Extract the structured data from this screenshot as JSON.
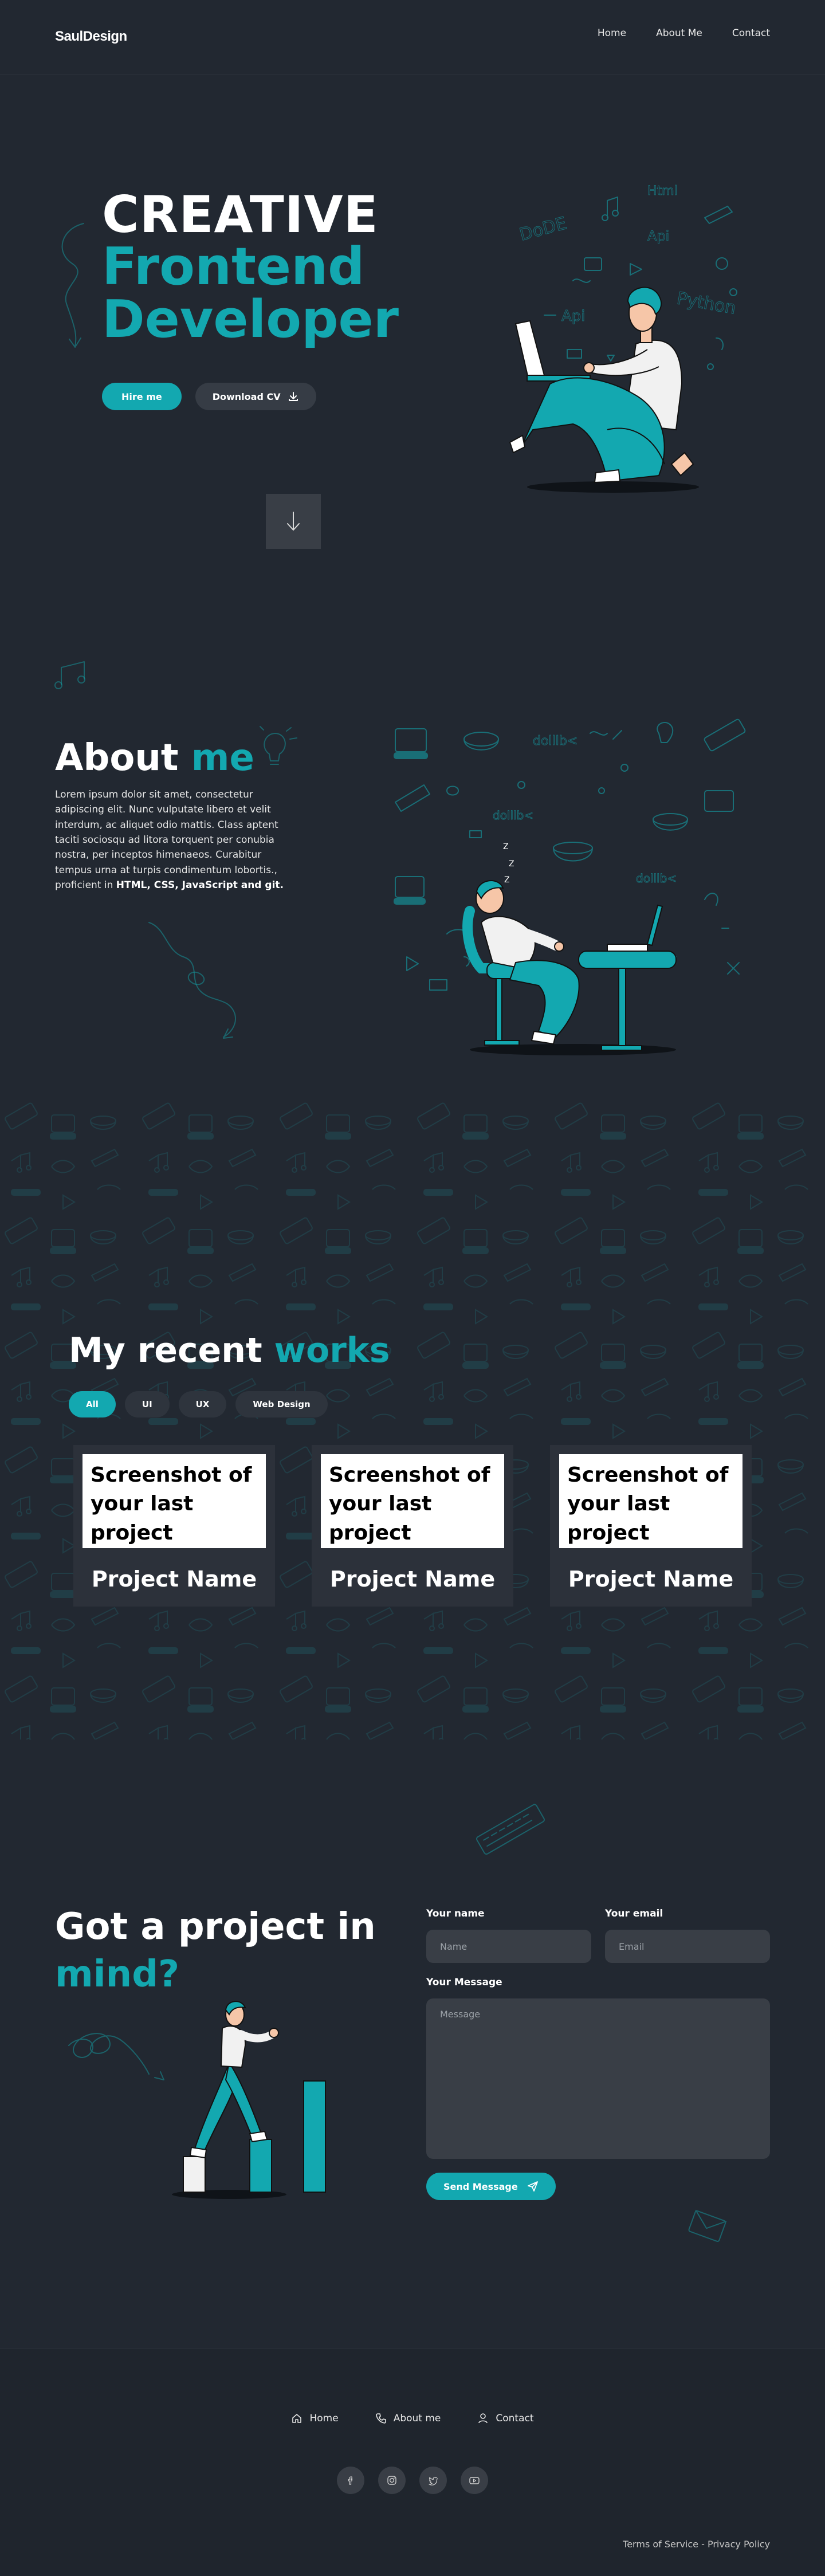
{
  "header": {
    "logo": "SaulDesign",
    "nav": [
      {
        "label": "Home"
      },
      {
        "label": "About Me"
      },
      {
        "label": "Contact"
      }
    ]
  },
  "hero": {
    "line1": "CREATIVE",
    "line2": "Frontend",
    "line3": "Developer",
    "hire_label": "Hire me",
    "cv_label": "Download CV",
    "scroll_icon": "arrow-down-icon"
  },
  "about": {
    "title_plain": "About ",
    "title_accent": "me",
    "text": "Lorem ipsum dolor sit amet, consectetur adipiscing elit. Nunc vulputate libero et velit interdum, ac aliquet odio mattis. Class aptent taciti sociosqu ad litora torquent per conubia nostra, per inceptos himenaeos. Curabitur tempus urna at turpis condimentum lobortis., proficient in ",
    "skills": "HTML, CSS, JavaScript and git."
  },
  "works": {
    "title_plain": "My recent ",
    "title_accent": "works",
    "filters": [
      {
        "label": "All",
        "active": true
      },
      {
        "label": "UI",
        "active": false
      },
      {
        "label": "UX",
        "active": false
      },
      {
        "label": "Web Design",
        "active": false
      }
    ],
    "projects": [
      {
        "screenshot": "Screenshot of your last project",
        "name": "Project Name"
      },
      {
        "screenshot": "Screenshot of your last project",
        "name": "Project Name"
      },
      {
        "screenshot": "Screenshot of your last project",
        "name": "Project Name"
      }
    ]
  },
  "contact": {
    "title_line1": "Got a project in",
    "title_line2": "mind?",
    "name_label": "Your name",
    "name_placeholder": "Name",
    "email_label": "Your email",
    "email_placeholder": "Email",
    "message_label": "Your Message",
    "message_placeholder": "Message",
    "send_label": "Send Message"
  },
  "footer": {
    "links": [
      {
        "label": "Home",
        "icon": "home-icon"
      },
      {
        "label": "About me",
        "icon": "phone-icon"
      },
      {
        "label": "Contact",
        "icon": "user-icon"
      }
    ],
    "socials": [
      "facebook-icon",
      "instagram-icon",
      "twitter-icon",
      "youtube-icon"
    ],
    "terms": "Terms of Service",
    "separator": " - ",
    "privacy": "Privacy Policy"
  },
  "colors": {
    "background": "#222831",
    "accent": "#13a8b0",
    "surface": "#393e46",
    "card": "#2c313a"
  }
}
